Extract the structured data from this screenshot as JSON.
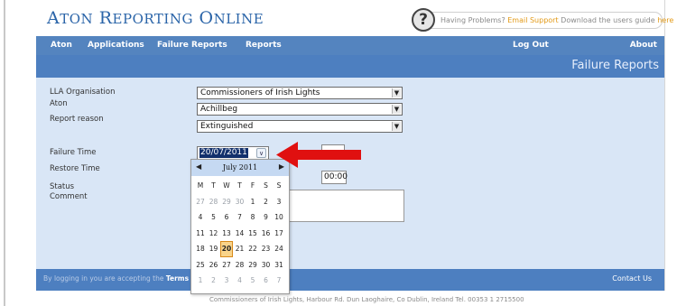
{
  "header": {
    "logo_big1": "A",
    "logo_small1": "TON",
    "logo_big2": "R",
    "logo_small2": "EPORTING",
    "logo_big3": "O",
    "logo_small3": "NLINE",
    "help_text": "Having Problems? ",
    "email_support": "Email Support",
    "download_text": "  Download the users guide ",
    "here_link": "here",
    "help_icon": "question-mark-icon"
  },
  "nav": {
    "items": [
      "Aton",
      "Applications",
      "Failure Reports",
      "Reports"
    ],
    "logout": "Log Out",
    "about": "About"
  },
  "page_title": "Failure Reports",
  "form": {
    "lla_label": "LLA Organisation",
    "lla_value": "Commissioners of Irish Lights",
    "aton_label": "Aton",
    "aton_value": "Achillbeg",
    "reason_label": "Report reason",
    "reason_value": "Extinguished",
    "failure_time_label": "Failure Time",
    "failure_date": "20/07/2011",
    "restore_time_label": "Restore Time",
    "restore_time_value": "00:00",
    "status_label": "Status",
    "comment_label": "Comment"
  },
  "calendar": {
    "month": "July 2011",
    "prev": "◀",
    "next": "▶",
    "dow": [
      "M",
      "T",
      "W",
      "T",
      "F",
      "S",
      "S"
    ],
    "weeks": [
      [
        "27",
        "28",
        "29",
        "30",
        "1",
        "2",
        "3"
      ],
      [
        "4",
        "5",
        "6",
        "7",
        "8",
        "9",
        "10"
      ],
      [
        "11",
        "12",
        "13",
        "14",
        "15",
        "16",
        "17"
      ],
      [
        "18",
        "19",
        "20",
        "21",
        "22",
        "23",
        "24"
      ],
      [
        "25",
        "26",
        "27",
        "28",
        "29",
        "30",
        "31"
      ],
      [
        "1",
        "2",
        "3",
        "4",
        "5",
        "6",
        "7"
      ]
    ],
    "selected": "20"
  },
  "footer": {
    "accept_text": "By logging in you are accepting the ",
    "terms": "Terms of",
    "contact": "Contact Us",
    "address": "Commissioners of Irish Lights, Harbour Rd. Dun Laoghaire, Co Dublin, Ireland Tel. 00353 1 2715500"
  },
  "colors": {
    "nav_blue": "#5484bf",
    "band_blue": "#4d7fc0",
    "content_bg": "#d9e6f6",
    "annotation_arrow": "#e01010",
    "today_highlight": "#f9d48a"
  }
}
